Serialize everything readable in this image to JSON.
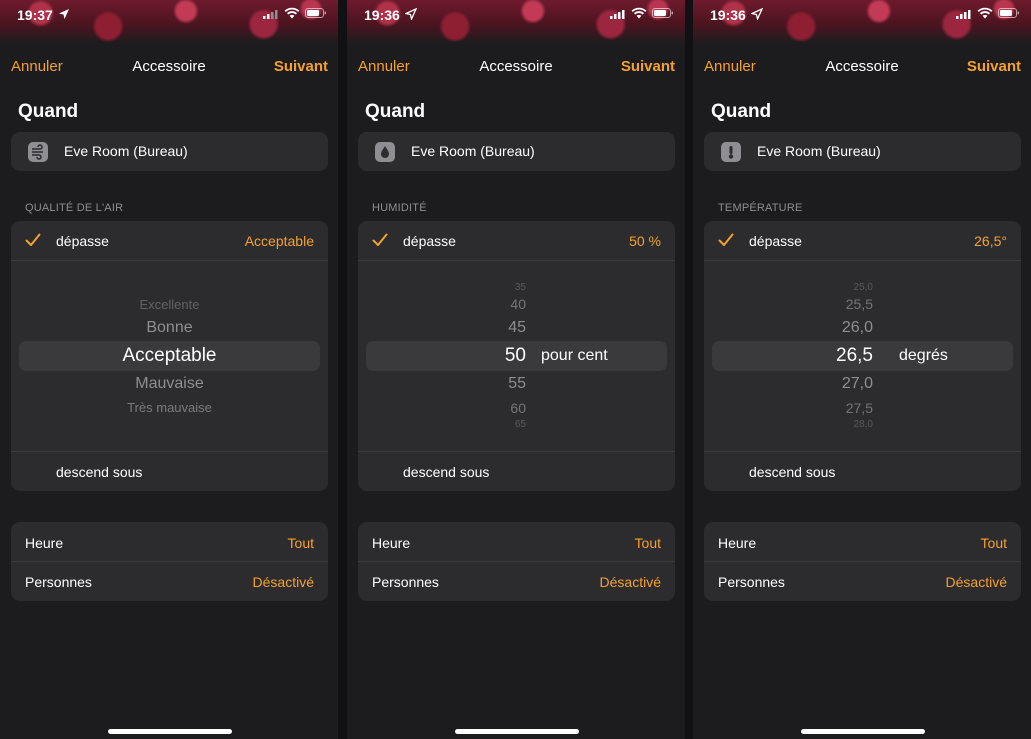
{
  "accent_color": "#f4a12e",
  "screens": [
    {
      "status": {
        "time": "19:37"
      },
      "nav": {
        "cancel": "Annuler",
        "title": "Accessoire",
        "next": "Suivant"
      },
      "section_title": "Quand",
      "accessory": {
        "name": "Eve Room (Bureau)",
        "icon": "air-quality-icon"
      },
      "group_label": "QUALITÉ DE L'AIR",
      "condition": {
        "above_label": "dépasse",
        "above_value": "Acceptable",
        "below_label": "descend sous"
      },
      "picker": {
        "rows": [
          "Excellente",
          "Bonne",
          "Acceptable",
          "Mauvaise",
          "Très mauvaise"
        ],
        "selected": "Acceptable"
      },
      "settings": [
        {
          "label": "Heure",
          "value": "Tout"
        },
        {
          "label": "Personnes",
          "value": "Désactivé"
        }
      ]
    },
    {
      "status": {
        "time": "19:36"
      },
      "nav": {
        "cancel": "Annuler",
        "title": "Accessoire",
        "next": "Suivant"
      },
      "section_title": "Quand",
      "accessory": {
        "name": "Eve Room (Bureau)",
        "icon": "water-drop-icon"
      },
      "group_label": "HUMIDITÉ",
      "condition": {
        "above_label": "dépasse",
        "above_value": "50 %",
        "below_label": "descend sous"
      },
      "picker": {
        "rows": [
          "35",
          "40",
          "45",
          "50",
          "55",
          "60",
          "65"
        ],
        "selected": "50",
        "unit": "pour cent"
      },
      "settings": [
        {
          "label": "Heure",
          "value": "Tout"
        },
        {
          "label": "Personnes",
          "value": "Désactivé"
        }
      ]
    },
    {
      "status": {
        "time": "19:36"
      },
      "nav": {
        "cancel": "Annuler",
        "title": "Accessoire",
        "next": "Suivant"
      },
      "section_title": "Quand",
      "accessory": {
        "name": "Eve Room (Bureau)",
        "icon": "thermometer-icon"
      },
      "group_label": "TEMPÉRATURE",
      "condition": {
        "above_label": "dépasse",
        "above_value": "26,5°",
        "below_label": "descend sous"
      },
      "picker": {
        "rows": [
          "25,0",
          "25,5",
          "26,0",
          "26,5",
          "27,0",
          "27,5",
          "28,0"
        ],
        "selected": "26,5",
        "unit": "degrés"
      },
      "settings": [
        {
          "label": "Heure",
          "value": "Tout"
        },
        {
          "label": "Personnes",
          "value": "Désactivé"
        }
      ]
    }
  ]
}
